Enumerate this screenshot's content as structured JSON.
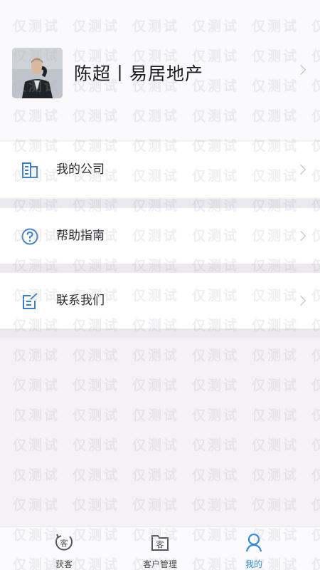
{
  "profile": {
    "name": "陈超丨易居地产"
  },
  "menu": [
    {
      "label": "我的公司",
      "icon": "building-icon"
    },
    {
      "label": "帮助指南",
      "icon": "help-icon"
    },
    {
      "label": "联系我们",
      "icon": "contact-edit-icon"
    }
  ],
  "tabbar": {
    "items": [
      {
        "label": "获客",
        "icon": "acquire-customer-icon"
      },
      {
        "label": "客户管理",
        "icon": "customer-folder-icon"
      },
      {
        "label": "我的",
        "icon": "person-icon"
      }
    ],
    "active_index": 2
  },
  "watermark": {
    "text": "仅测试"
  },
  "colors": {
    "accent": "#2f8ddb",
    "icon_blue": "#3a7fc4"
  }
}
